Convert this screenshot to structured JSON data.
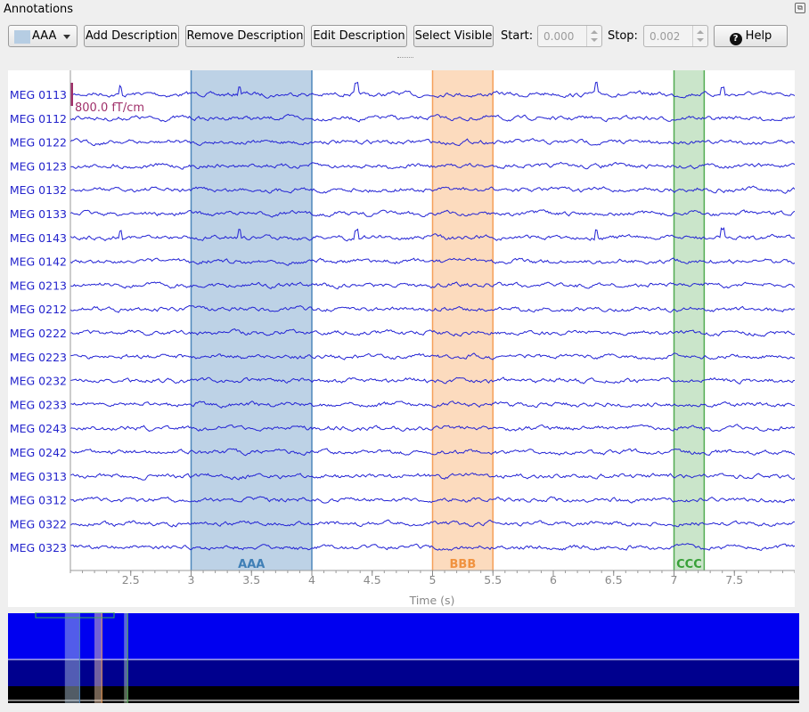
{
  "window": {
    "title": "Annotations"
  },
  "toolbar": {
    "description_selector": {
      "value": "AAA",
      "swatch_color": "#b6cde3"
    },
    "add_description": "Add Description",
    "remove_description": "Remove Description",
    "edit_description": "Edit Description",
    "select_visible": "Select Visible",
    "start_label": "Start:",
    "start_value": "0.000",
    "stop_label": "Stop:",
    "stop_value": "0.002",
    "help": "Help"
  },
  "plot": {
    "scale_label": "800.0 fT/cm",
    "xlabel": "Time (s)",
    "x_ticks": [
      "2.5",
      "3",
      "3.5",
      "4",
      "4.5",
      "5",
      "5.5",
      "6",
      "6.5",
      "7",
      "7.5"
    ],
    "xlim": [
      2.0,
      8.0
    ],
    "channels": [
      "MEG 0113",
      "MEG 0112",
      "MEG 0122",
      "MEG 0123",
      "MEG 0132",
      "MEG 0133",
      "MEG 0143",
      "MEG 0142",
      "MEG 0213",
      "MEG 0212",
      "MEG 0222",
      "MEG 0223",
      "MEG 0232",
      "MEG 0233",
      "MEG 0243",
      "MEG 0242",
      "MEG 0313",
      "MEG 0312",
      "MEG 0322",
      "MEG 0323"
    ],
    "trace_color": "#2323d4",
    "channel_label_color": "#2323cc",
    "annotations": [
      {
        "label": "AAA",
        "start": 3.0,
        "stop": 4.0,
        "fill": "#b6cde3",
        "edge": "#4f87bb",
        "text_color": "#3f7fb6"
      },
      {
        "label": "BBB",
        "start": 5.0,
        "stop": 5.5,
        "fill": "#fcd7b7",
        "edge": "#f5a05a",
        "text_color": "#f0923f"
      },
      {
        "label": "CCC",
        "start": 7.0,
        "stop": 7.25,
        "fill": "#c4e2c4",
        "edge": "#52ac52",
        "text_color": "#37a037"
      }
    ]
  },
  "overview": {
    "background_colors": [
      "#0000f0",
      "#00008e",
      "#000000"
    ]
  }
}
